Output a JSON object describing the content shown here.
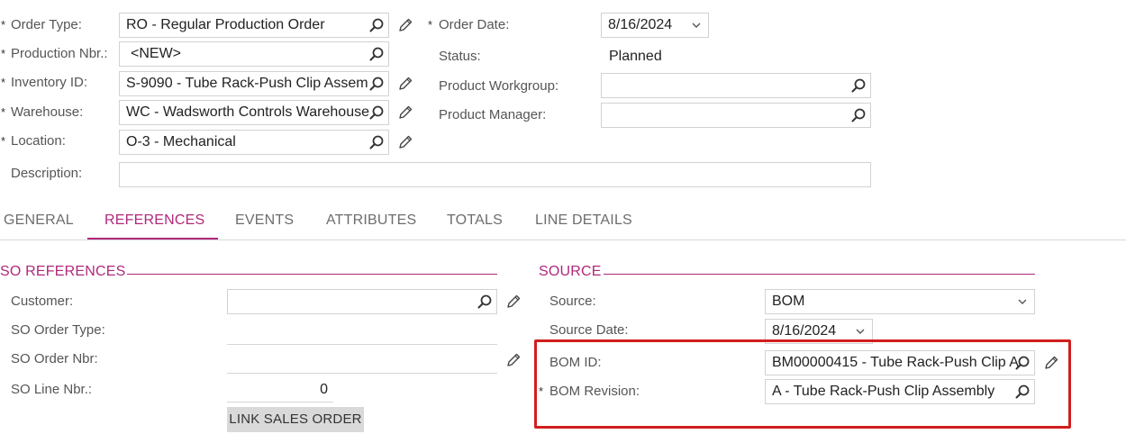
{
  "header": {
    "order_type": {
      "label": "Order Type:",
      "value": "RO - Regular Production Order"
    },
    "production_nbr": {
      "label": "Production Nbr.:",
      "value": "<NEW>"
    },
    "inventory_id": {
      "label": "Inventory ID:",
      "value": "S-9090 - Tube Rack-Push Clip Assem"
    },
    "warehouse": {
      "label": "Warehouse:",
      "value": "WC - Wadsworth Controls Warehouse"
    },
    "location": {
      "label": "Location:",
      "value": "O-3 - Mechanical"
    },
    "description": {
      "label": "Description:",
      "value": ""
    },
    "order_date": {
      "label": "Order Date:",
      "value": "8/16/2024"
    },
    "status": {
      "label": "Status:",
      "value": "Planned"
    },
    "product_workgroup": {
      "label": "Product Workgroup:",
      "value": ""
    },
    "product_manager": {
      "label": "Product Manager:",
      "value": ""
    }
  },
  "tabs": [
    {
      "label": "GENERAL",
      "active": false
    },
    {
      "label": "REFERENCES",
      "active": true
    },
    {
      "label": "EVENTS",
      "active": false
    },
    {
      "label": "ATTRIBUTES",
      "active": false
    },
    {
      "label": "TOTALS",
      "active": false
    },
    {
      "label": "LINE DETAILS",
      "active": false
    }
  ],
  "so_references": {
    "title": "SO REFERENCES",
    "customer": {
      "label": "Customer:",
      "value": ""
    },
    "so_order_type": {
      "label": "SO Order Type:",
      "value": ""
    },
    "so_order_nbr": {
      "label": "SO Order Nbr:",
      "value": ""
    },
    "so_line_nbr": {
      "label": "SO Line Nbr.:",
      "value": "0"
    },
    "link_button": "LINK SALES ORDER"
  },
  "source": {
    "title": "SOURCE",
    "source": {
      "label": "Source:",
      "value": "BOM"
    },
    "source_date": {
      "label": "Source Date:",
      "value": "8/16/2024"
    },
    "bom_id": {
      "label": "BOM ID:",
      "value": "BM00000415 - Tube Rack-Push Clip A"
    },
    "bom_revision": {
      "label": "BOM Revision:",
      "value": "A - Tube Rack-Push Clip Assembly"
    }
  },
  "required_marker": "*",
  "colors": {
    "accent": "#b0287a",
    "highlight": "#d11e1e",
    "border": "#d2d2d2"
  },
  "icons": {
    "search": "search-icon",
    "edit": "pencil-icon",
    "dropdown": "chevron-down-icon"
  }
}
